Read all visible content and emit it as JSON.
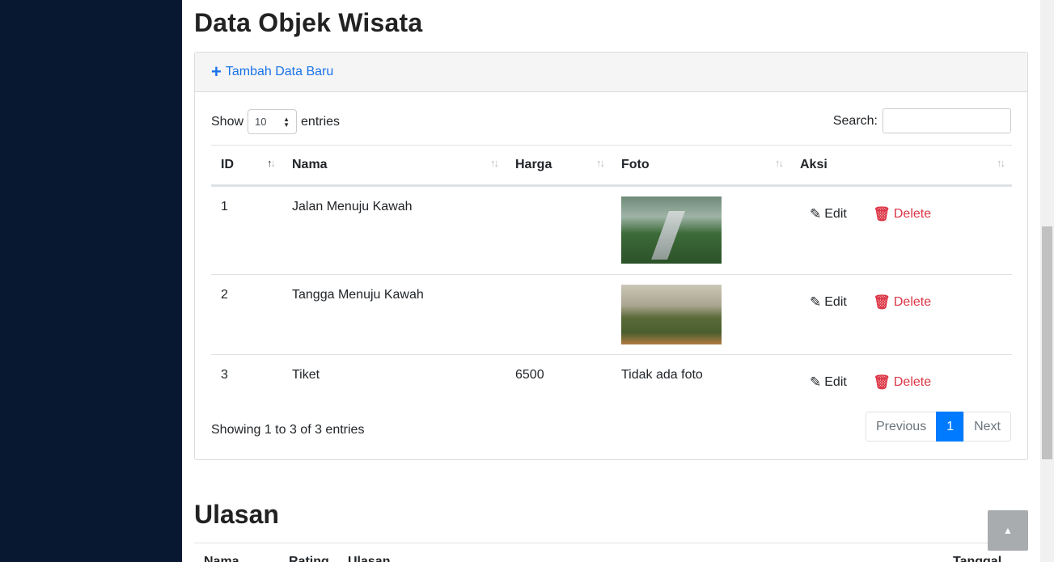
{
  "page": {
    "title": "Data Objek Wisata",
    "add_button": "Tambah Data Baru",
    "length": {
      "prefix": "Show",
      "value": "10",
      "suffix": "entries"
    },
    "search": {
      "label": "Search:",
      "value": ""
    },
    "columns": [
      "ID",
      "Nama",
      "Harga",
      "Foto",
      "Aksi"
    ],
    "rows": [
      {
        "id": "1",
        "nama": "Jalan Menuju Kawah",
        "harga": "",
        "foto": "image",
        "foto_text": ""
      },
      {
        "id": "2",
        "nama": "Tangga Menuju Kawah",
        "harga": "",
        "foto": "image",
        "foto_text": ""
      },
      {
        "id": "3",
        "nama": "Tiket",
        "harga": "6500",
        "foto": "none",
        "foto_text": "Tidak ada foto"
      }
    ],
    "actions": {
      "edit": "Edit",
      "delete": "Delete"
    },
    "info": "Showing 1 to 3 of 3 entries",
    "pagination": {
      "previous": "Previous",
      "current": "1",
      "next": "Next"
    }
  },
  "reviews": {
    "title": "Ulasan",
    "columns": [
      "Nama",
      "Rating",
      "Ulasan",
      "Tanggal"
    ]
  },
  "colors": {
    "sidebar": "#081830",
    "link": "#1a73e8",
    "danger": "#dc3545",
    "primary": "#007bff"
  },
  "icons": {
    "add": "plus-icon",
    "edit": "edit-icon",
    "delete": "trash-icon",
    "back_to_top": "chevron-up-icon"
  }
}
